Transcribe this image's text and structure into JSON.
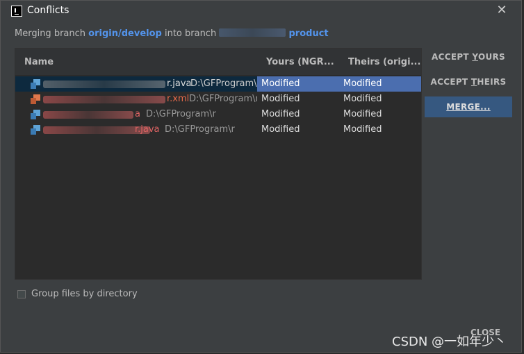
{
  "dialog": {
    "title": "Conflicts",
    "subtitle_prefix": "Merging branch",
    "source_branch": "origin/develop",
    "subtitle_mid": "into branch",
    "target_branch": "product"
  },
  "table": {
    "columns": {
      "name": "Name",
      "yours": "Yours (NGR...",
      "theirs": "Theirs (origi..."
    },
    "rows": [
      {
        "name": "r.java",
        "path": "D:\\GFProgram\\r",
        "type": "java",
        "yours": "Modified",
        "theirs": "Modified",
        "selected": true
      },
      {
        "name": "r.xml",
        "path": "D:\\GFProgram\\r",
        "type": "xml",
        "yours": "Modified",
        "theirs": "Modified",
        "selected": false
      },
      {
        "name": "a",
        "path": "D:\\GFProgram\\r",
        "type": "java",
        "yours": "Modified",
        "theirs": "Modified",
        "selected": false
      },
      {
        "name": "r.java",
        "path": "D:\\GFProgram\\r",
        "type": "java",
        "yours": "Modified",
        "theirs": "Modified",
        "selected": false
      }
    ]
  },
  "buttons": {
    "accept_yours_pre": "ACCEPT ",
    "accept_yours_mnemonic": "Y",
    "accept_yours_post": "OURS",
    "accept_theirs_pre": "ACCEPT ",
    "accept_theirs_mnemonic": "T",
    "accept_theirs_post": "HEIRS",
    "merge_mnemonic": "M",
    "merge_post": "ERGE...",
    "close": "CLOSE"
  },
  "options": {
    "group_by_directory": "Group files by directory",
    "group_by_directory_checked": false
  },
  "watermark": "CSDN @一如年少丶",
  "icons": {
    "close": "close-icon",
    "file_java": "java-file-icon",
    "file_xml": "xml-file-icon",
    "app": "intellij-icon"
  }
}
